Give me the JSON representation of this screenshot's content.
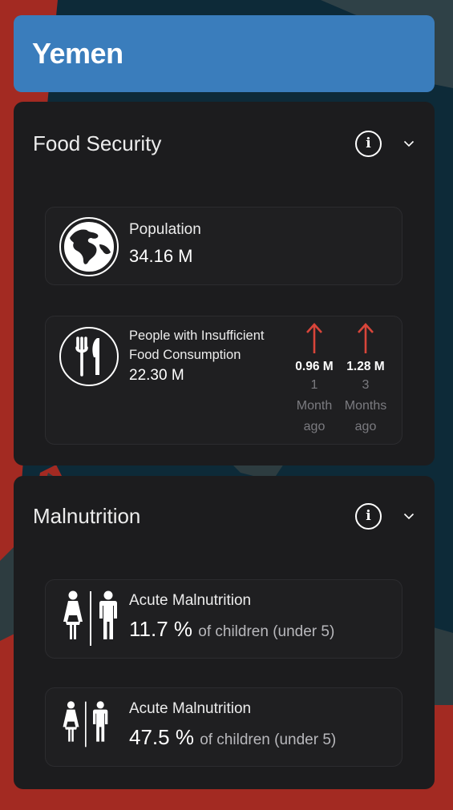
{
  "country": {
    "title": "Yemen"
  },
  "colors": {
    "header_bg": "#3a7dbc",
    "panel_bg": "#1c1c1e",
    "card_bg": "#1f1f21",
    "trend_up": "#d8453a",
    "map_red": "#a32a22",
    "map_sea": "#0d2a38"
  },
  "food_security": {
    "title": "Food Security",
    "info_icon": "info-icon",
    "collapse_icon": "chevron-down-icon",
    "population": {
      "icon": "globe-icon",
      "label": "Population",
      "value": "34.16 M"
    },
    "insufficient_food": {
      "icon": "fork-knife-icon",
      "label": "People with Insufficient Food Consumption",
      "value": "22.30 M",
      "trends": [
        {
          "icon": "arrow-up-icon",
          "value": "0.96 M",
          "period_num": "1",
          "period_unit": "Month",
          "period_suffix": "ago"
        },
        {
          "icon": "arrow-up-icon",
          "value": "1.28 M",
          "period_num": "3",
          "period_unit": "Months",
          "period_suffix": "ago"
        }
      ]
    }
  },
  "malnutrition": {
    "title": "Malnutrition",
    "info_icon": "info-icon",
    "collapse_icon": "chevron-down-icon",
    "cards": [
      {
        "icon": "woman-man-icon",
        "label": "Acute Malnutrition",
        "value": "11.7 %",
        "unit": "of children (under 5)"
      },
      {
        "icon": "woman-man-icon",
        "label": "Acute Malnutrition",
        "value": "47.5 %",
        "unit": "of children (under 5)"
      }
    ]
  }
}
